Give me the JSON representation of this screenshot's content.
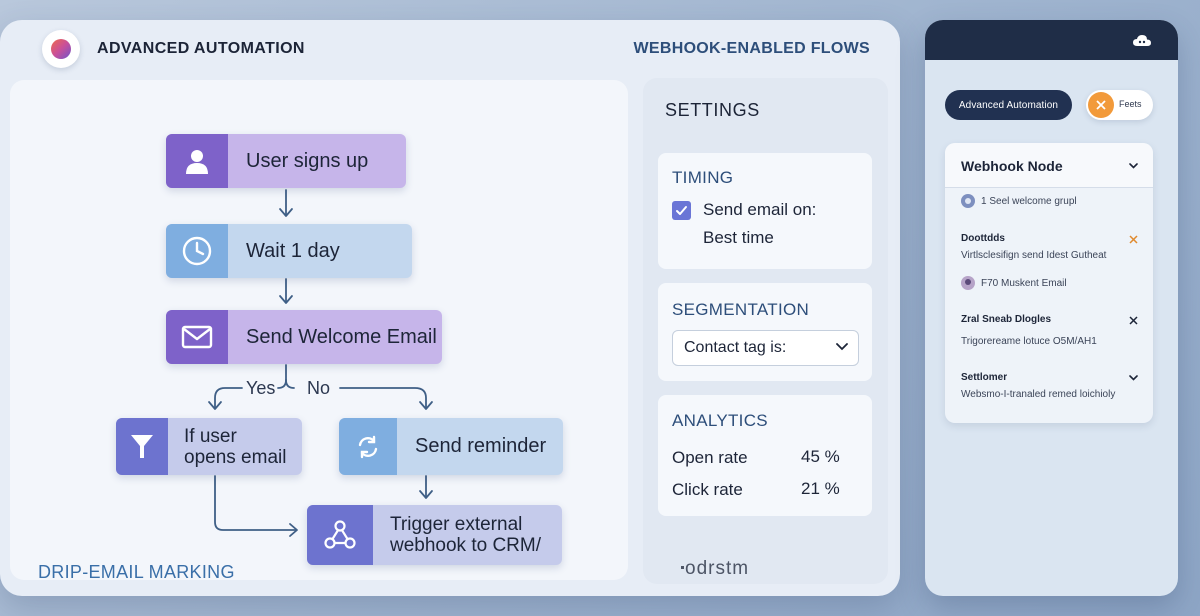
{
  "header": {
    "app_title": "ADVANCED AUTOMATION",
    "flows_title": "WEBHOOK-ENABLED FLOWS"
  },
  "flow": {
    "nodes": [
      {
        "id": "signup",
        "label": "User signs up",
        "icon": "user-icon"
      },
      {
        "id": "wait",
        "label": "Wait 1 day",
        "icon": "clock-icon"
      },
      {
        "id": "send_welcome",
        "label": "Send Welcome Email",
        "icon": "mail-icon"
      },
      {
        "id": "if_opens",
        "label_line1": "If user",
        "label_line2": "opens email",
        "icon": "filter-icon"
      },
      {
        "id": "reminder",
        "label": "Send reminder",
        "icon": "refresh-icon"
      },
      {
        "id": "webhook",
        "label_line1": "Trigger external",
        "label_line2": "webhook to CRM/",
        "icon": "share-nodes-icon"
      }
    ],
    "branch_yes": "Yes",
    "branch_no": "No",
    "footer_label": "DRIP-EMAIL MARKING"
  },
  "settings": {
    "title": "SETTINGS",
    "timing": {
      "heading": "TIMING",
      "checked": true,
      "line1": "Send email on:",
      "line2": "Best time"
    },
    "segmentation": {
      "heading": "SEGMENTATION",
      "select_value": "Contact tag is:"
    },
    "analytics": {
      "heading": "ANALYTICS",
      "metrics": [
        {
          "label": "Open rate",
          "value": "45 %"
        },
        {
          "label": "Click rate",
          "value": "21 %"
        }
      ]
    },
    "footer_text": "odrstm"
  },
  "device": {
    "pill_primary": "Advanced Automation",
    "pill_secondary": "Feets",
    "webhook": {
      "title": "Webhook Node",
      "row1": "1 Seel welcome grupl",
      "row2_title": "Doottdds",
      "row2_text": "Virtlsclesifign send Idest Gutheat",
      "row3": "F70 Muskent Email",
      "row4_title": "Zral Sneab Dlogles",
      "row4_text": "Trigorereame lotuce O5M/AH1",
      "row5_title": "Settlomer",
      "row5_text": "Websmo-I-tranaled remed loichioly"
    }
  },
  "colors": {
    "accent_purple": "#7e62c9",
    "accent_blue": "#7faee0",
    "navy": "#213151",
    "orange": "#f29a3a"
  }
}
